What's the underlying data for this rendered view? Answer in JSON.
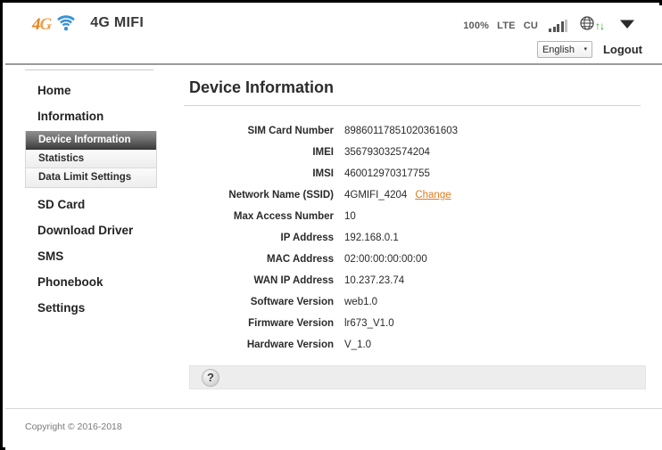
{
  "header": {
    "logo_4g": "4G",
    "logo_wifi_icon": "wifi-icon",
    "brand_title": "4G MIFI",
    "status": {
      "battery_percent": "100%",
      "network_type": "LTE",
      "carrier": "CU",
      "signal_icon": "signal-bars-icon",
      "globe_icon": "globe-icon",
      "transfer_icon": "up-down-arrows-icon",
      "transfer_glyph": "↑↓",
      "battery_icon": "battery-icon"
    },
    "language": {
      "selected": "English",
      "caret": "▾",
      "options": [
        "English"
      ]
    },
    "logout_label": "Logout"
  },
  "sidebar": {
    "items": [
      {
        "label": "Home",
        "type": "top"
      },
      {
        "label": "Information",
        "type": "top"
      },
      {
        "label": "SD Card",
        "type": "top"
      },
      {
        "label": "Download Driver",
        "type": "top"
      },
      {
        "label": "SMS",
        "type": "top"
      },
      {
        "label": "Phonebook",
        "type": "top"
      },
      {
        "label": "Settings",
        "type": "top"
      }
    ],
    "submenu": [
      {
        "label": "Device Information",
        "active": true
      },
      {
        "label": "Statistics",
        "active": false
      },
      {
        "label": "Data Limit Settings",
        "active": false
      }
    ]
  },
  "main": {
    "title": "Device Information",
    "rows": [
      {
        "label": "SIM Card Number",
        "value": "89860117851020361603"
      },
      {
        "label": "IMEI",
        "value": "356793032574204"
      },
      {
        "label": "IMSI",
        "value": "460012970317755"
      },
      {
        "label": "Network Name (SSID)",
        "value": "4GMIFI_4204",
        "link": "Change"
      },
      {
        "label": "Max Access Number",
        "value": "10"
      },
      {
        "label": "IP Address",
        "value": "192.168.0.1"
      },
      {
        "label": "MAC Address",
        "value": "02:00:00:00:00:00"
      },
      {
        "label": "WAN IP Address",
        "value": "10.237.23.74"
      },
      {
        "label": "Software Version",
        "value": "web1.0"
      },
      {
        "label": "Firmware Version",
        "value": "lr673_V1.0"
      },
      {
        "label": "Hardware Version",
        "value": "V_1.0"
      }
    ],
    "help_button": "?"
  },
  "footer": {
    "copyright": "Copyright © 2016-2018"
  },
  "colors": {
    "accent_orange": "#e07b1e",
    "logo_orange": "#e8821e",
    "wifi_blue": "#3a93d6",
    "transfer_green": "#17a117",
    "active_item_bg": "#3d3d3d"
  }
}
